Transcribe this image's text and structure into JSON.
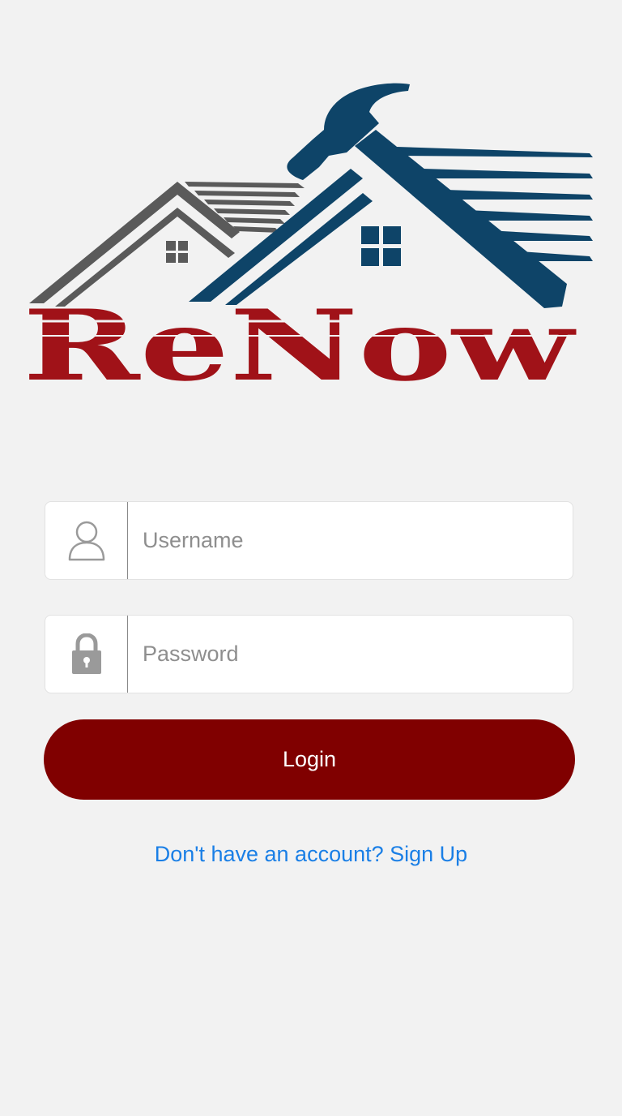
{
  "logo": {
    "text": "ReNow",
    "colors": {
      "text_red": "#a01218",
      "hammer_blue": "#0e4468",
      "roof_gray": "#5a5a5a"
    }
  },
  "form": {
    "username": {
      "placeholder": "Username",
      "value": "",
      "icon": "user-icon"
    },
    "password": {
      "placeholder": "Password",
      "value": "",
      "icon": "lock-icon"
    },
    "login_label": "Login",
    "signup_text": "Don't have an account? Sign Up"
  },
  "colors": {
    "background": "#f2f2f2",
    "button": "#800000",
    "link": "#1a7fe6"
  }
}
